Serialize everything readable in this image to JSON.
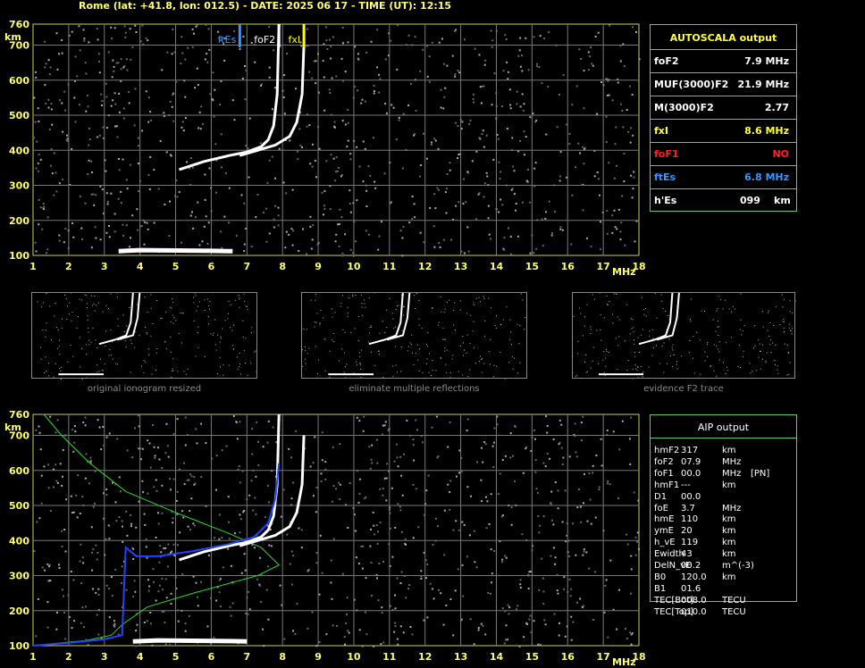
{
  "header": "Rome (lat: +41.8, lon: 012.5) - DATE: 2025 06 17 - TIME (UT): 12:15",
  "chart_data": [
    {
      "type": "scatter",
      "name_id": "ionogram-top",
      "xlabel": "MHz",
      "ylabel": "km",
      "xlim": [
        1,
        18
      ],
      "ylim": [
        100,
        760
      ],
      "x_ticks": [
        "1",
        "2",
        "3",
        "4",
        "5",
        "6",
        "7",
        "8",
        "9",
        "10",
        "11",
        "12",
        "13",
        "14",
        "15",
        "16",
        "17",
        "18"
      ],
      "y_ticks": [
        "100",
        "200",
        "300",
        "400",
        "500",
        "600",
        "700",
        "760"
      ],
      "markers": [
        {
          "label": "ftEs",
          "x": 6.8,
          "color": "#3399ff"
        },
        {
          "label": "foF2",
          "x": 7.9,
          "color": "#ffffff"
        },
        {
          "label": "fxI",
          "x": 8.6,
          "color": "#ffff00"
        }
      ],
      "traces": {
        "es_layer": [
          [
            3.4,
            112
          ],
          [
            4.0,
            115
          ],
          [
            5.0,
            114
          ],
          [
            6.0,
            113
          ],
          [
            6.6,
            112
          ]
        ],
        "o_trace": [
          [
            5.1,
            345
          ],
          [
            5.8,
            368
          ],
          [
            6.5,
            385
          ],
          [
            7.0,
            395
          ],
          [
            7.4,
            410
          ],
          [
            7.6,
            430
          ],
          [
            7.75,
            470
          ],
          [
            7.85,
            560
          ],
          [
            7.9,
            760
          ]
        ],
        "x_trace": [
          [
            6.8,
            385
          ],
          [
            7.3,
            400
          ],
          [
            7.8,
            415
          ],
          [
            8.2,
            440
          ],
          [
            8.4,
            480
          ],
          [
            8.55,
            560
          ],
          [
            8.6,
            700
          ]
        ]
      }
    },
    {
      "type": "line",
      "name_id": "ionogram-bottom",
      "xlabel": "MHz",
      "ylabel": "km",
      "xlim": [
        1,
        18
      ],
      "ylim": [
        100,
        760
      ],
      "x_ticks": [
        "1",
        "2",
        "3",
        "4",
        "5",
        "6",
        "7",
        "8",
        "9",
        "10",
        "11",
        "12",
        "13",
        "14",
        "15",
        "16",
        "17",
        "18"
      ],
      "y_ticks": [
        "100",
        "200",
        "300",
        "400",
        "500",
        "600",
        "700",
        "760"
      ],
      "traces": {
        "es_layer": [
          [
            3.8,
            112
          ],
          [
            4.5,
            115
          ],
          [
            5.5,
            114
          ],
          [
            6.5,
            113
          ],
          [
            7.0,
            112
          ]
        ],
        "o_trace": [
          [
            5.1,
            345
          ],
          [
            5.8,
            368
          ],
          [
            6.5,
            385
          ],
          [
            7.0,
            395
          ],
          [
            7.4,
            410
          ],
          [
            7.6,
            430
          ],
          [
            7.75,
            470
          ],
          [
            7.85,
            560
          ],
          [
            7.9,
            760
          ]
        ],
        "x_trace": [
          [
            6.8,
            385
          ],
          [
            7.3,
            400
          ],
          [
            7.8,
            415
          ],
          [
            8.2,
            440
          ],
          [
            8.4,
            480
          ],
          [
            8.55,
            560
          ],
          [
            8.6,
            700
          ]
        ],
        "profile_green": [
          [
            1.3,
            760
          ],
          [
            1.8,
            700
          ],
          [
            2.6,
            620
          ],
          [
            3.6,
            540
          ],
          [
            5.0,
            480
          ],
          [
            6.5,
            420
          ],
          [
            7.4,
            380
          ],
          [
            7.9,
            330
          ],
          [
            7.3,
            300
          ],
          [
            5.5,
            250
          ],
          [
            4.2,
            210
          ],
          [
            3.5,
            160
          ],
          [
            3.2,
            130
          ],
          [
            2.5,
            115
          ],
          [
            1.5,
            105
          ],
          [
            1.0,
            100
          ]
        ],
        "profile_blue": [
          [
            1.0,
            100
          ],
          [
            2.0,
            108
          ],
          [
            3.0,
            118
          ],
          [
            3.5,
            130
          ],
          [
            3.6,
            380
          ],
          [
            3.9,
            355
          ],
          [
            4.5,
            355
          ],
          [
            5.5,
            370
          ],
          [
            6.5,
            390
          ],
          [
            7.2,
            410
          ],
          [
            7.6,
            450
          ],
          [
            7.8,
            520
          ],
          [
            7.9,
            620
          ]
        ]
      }
    }
  ],
  "autoscala": {
    "title": "AUTOSCALA output",
    "rows": [
      {
        "label": "foF2",
        "value": "7.9 MHz",
        "color": "#ffffff"
      },
      {
        "label": "MUF(3000)F2",
        "value": "21.9 MHz",
        "color": "#ffffff"
      },
      {
        "label": "M(3000)F2",
        "value": "2.77",
        "color": "#ffffff"
      },
      {
        "label": "fxI",
        "value": "8.6 MHz",
        "color": "#ffff33"
      },
      {
        "label": "foF1",
        "value": "NO",
        "color": "#ff2222"
      },
      {
        "label": "ftEs",
        "value": "6.8 MHz",
        "color": "#3399ff"
      },
      {
        "label": "h'Es",
        "value": "099",
        "unit": "km",
        "color": "#ffffff"
      }
    ]
  },
  "aip": {
    "title": "AIP output",
    "rows": [
      {
        "label": "hmF2",
        "value": "317",
        "unit": "km",
        "extra": ""
      },
      {
        "label": "foF2",
        "value": "07.9",
        "unit": "MHz",
        "extra": ""
      },
      {
        "label": "foF1",
        "value": "00.0",
        "unit": "MHz",
        "extra": "[PN]"
      },
      {
        "label": "hmF1",
        "value": "---",
        "unit": "km",
        "extra": ""
      },
      {
        "label": "D1",
        "value": "00.0",
        "unit": "",
        "extra": ""
      },
      {
        "label": "foE",
        "value": "3.7",
        "unit": "MHz",
        "extra": ""
      },
      {
        "label": "hmE",
        "value": "110",
        "unit": "km",
        "extra": ""
      },
      {
        "label": "ymE",
        "value": "20",
        "unit": "km",
        "extra": ""
      },
      {
        "label": "h_vE",
        "value": "119",
        "unit": "km",
        "extra": ""
      },
      {
        "label": "Ewidth",
        "value": "43",
        "unit": "km",
        "extra": ""
      },
      {
        "label": "DelN_vE",
        "value": "00.2",
        "unit": "m^(-3)",
        "extra": ""
      },
      {
        "label": "B0",
        "value": "120.0",
        "unit": "km",
        "extra": ""
      },
      {
        "label": "B1",
        "value": "01.6",
        "unit": "",
        "extra": ""
      },
      {
        "label": "TEC[Bot]",
        "value": "008.0",
        "unit": "TECU",
        "extra": ""
      },
      {
        "label": "TEC[Top]",
        "value": "010.0",
        "unit": "TECU",
        "extra": ""
      }
    ]
  },
  "thumbnails": [
    {
      "caption": "original ionogram resized"
    },
    {
      "caption": "eliminate multiple reflections"
    },
    {
      "caption": "evidence F2 trace"
    }
  ]
}
